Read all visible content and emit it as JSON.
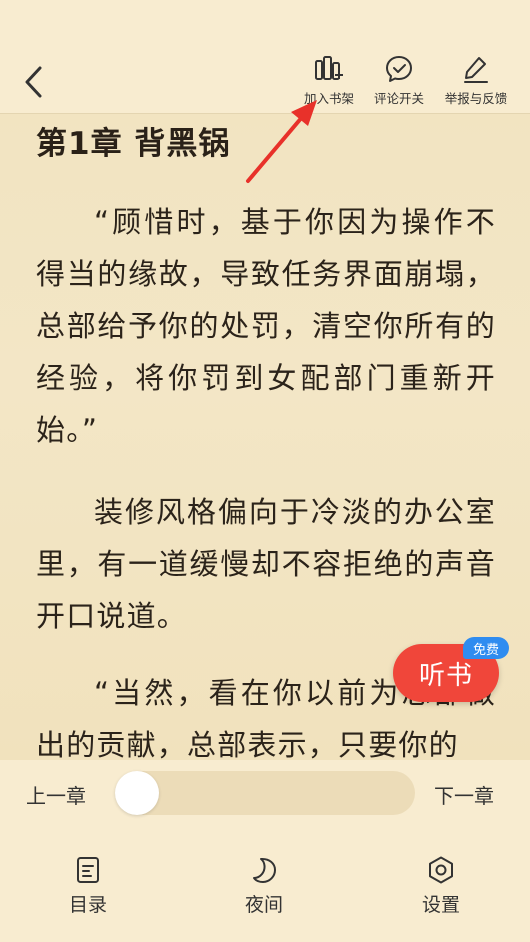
{
  "chapter": {
    "title": "第1章 背黑锅",
    "paragraphs": [
      "“顾惜时，基于你因为操作不得当的缘故，导致任务界面崩塌，总部给予你的处罚，清空你所有的经验，将你罚到女配部门重新开始。”",
      "装修风格偏向于冷淡的办公室里，有一道缓慢却不容拒绝的声音开口说道。",
      "“当然，看在你以前为总部做出的贡献，总部表示，只要你的"
    ]
  },
  "topbar": {
    "back_icon": "chevron-left-icon",
    "actions": [
      {
        "label": "加入书架",
        "icon": "bookshelf-add-icon"
      },
      {
        "label": "评论开关",
        "icon": "comment-toggle-icon"
      },
      {
        "label": "举报与反馈",
        "icon": "edit-pen-icon"
      }
    ]
  },
  "listen": {
    "label": "听书",
    "badge": "免费",
    "color": "#f0463a",
    "badge_color": "#2f8cf0"
  },
  "annotation": {
    "color": "#e8312a"
  },
  "progress": {
    "prev_label": "上一章",
    "next_label": "下一章",
    "value": 0
  },
  "bottom_menu": [
    {
      "label": "目录",
      "icon": "toc-icon"
    },
    {
      "label": "夜间",
      "icon": "moon-icon"
    },
    {
      "label": "设置",
      "icon": "gear-icon"
    }
  ]
}
